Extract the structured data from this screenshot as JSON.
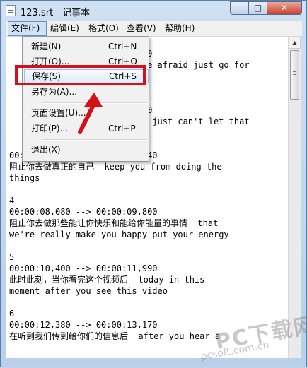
{
  "window": {
    "title": "123.srt - 记事本"
  },
  "window_buttons": {
    "minimize": "—",
    "maximize": "□",
    "close": "✕"
  },
  "menubar": {
    "file": "文件(F)",
    "edit": "编辑(E)",
    "format": "格式(O)",
    "view": "查看(V)",
    "help": "帮助(H)"
  },
  "file_menu": {
    "new": {
      "label": "新建(N)",
      "shortcut": "Ctrl+N"
    },
    "open": {
      "label": "打开(O)...",
      "shortcut": "Ctrl+O"
    },
    "save": {
      "label": "保存(S)",
      "shortcut": "Ctrl+S"
    },
    "save_as": {
      "label": "另存为(A)..."
    },
    "page_setup": {
      "label": "页面设置(U)..."
    },
    "print": {
      "label": "打印(P)...",
      "shortcut": "Ctrl+P"
    },
    "exit": {
      "label": "退出(X)"
    }
  },
  "editor": {
    "text": "                        ,710\n                        t be afraid just go for\n\n\n\n                        ,980\n                        you just can't let that\n\n\n00:00:06,030 --> 00:00:07,440\n阻止你去做真正的自己  keep you from doing the\nthings\n\n4\n00:00:08,080 --> 00:00:09,800\n阻止你去做那些能让你快乐和能给你能量的事情  that\nwe're really make you happy put your energy\n\n5\n00:00:10,400 --> 00:00:11,990\n此时此刻，当你看完这个视频后  today in this\nmoment after you see this video\n\n6\n00:00:12,380 --> 00:00:13,170\n在听到我们传到给你们的信息后  after you hear a"
  },
  "watermark": {
    "brand": "PC下载网",
    "domain": "pcsoft.com.cn"
  },
  "annotation": {
    "color": "#d51018",
    "arrow_icon": "red-arrow-icon"
  }
}
